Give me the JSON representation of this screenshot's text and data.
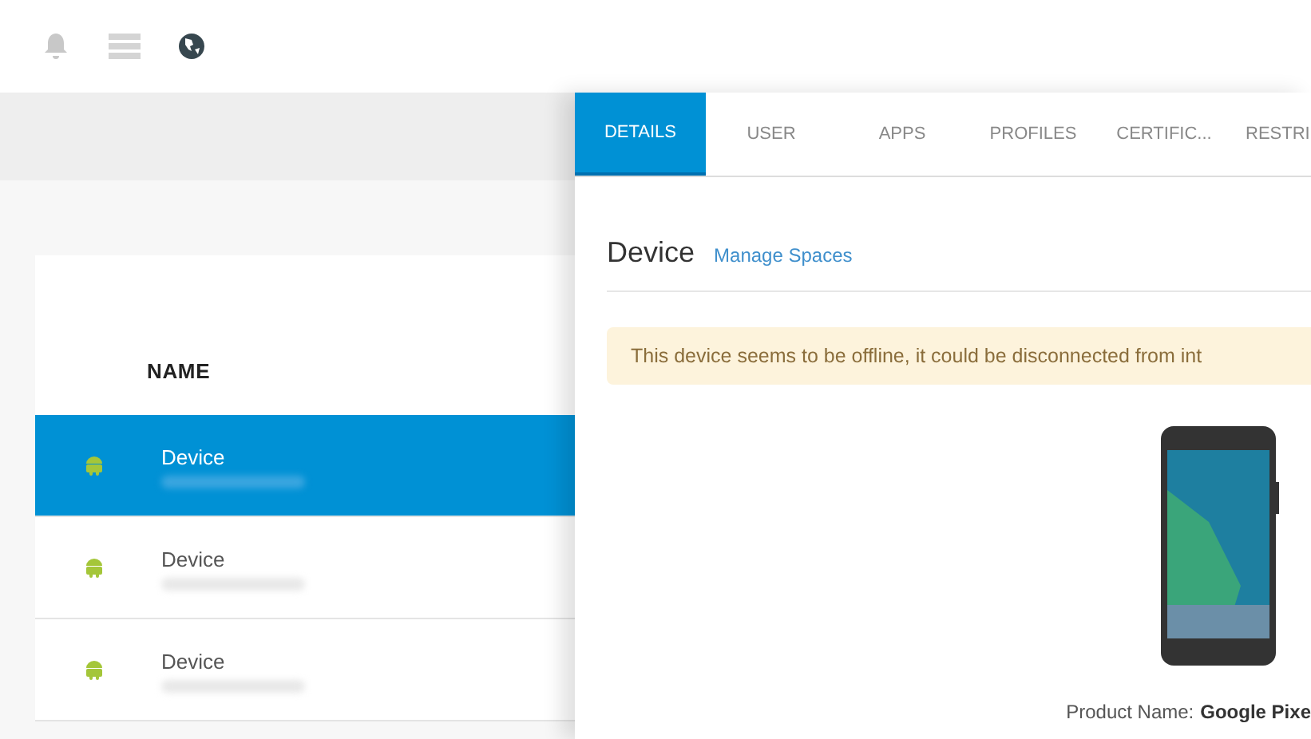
{
  "table": {
    "column": "NAME",
    "rows": [
      {
        "name": "Device",
        "selected": true
      },
      {
        "name": "Device",
        "selected": false
      },
      {
        "name": "Device",
        "selected": false
      }
    ]
  },
  "panel": {
    "tabs": [
      {
        "label": "DETAILS",
        "selected": true
      },
      {
        "label": "USER",
        "selected": false
      },
      {
        "label": "APPS",
        "selected": false
      },
      {
        "label": "PROFILES",
        "selected": false
      },
      {
        "label": "CERTIFIC...",
        "selected": false
      },
      {
        "label": "RESTRI",
        "selected": false
      }
    ],
    "title": "Device",
    "link": "Manage Spaces",
    "alert": "This device seems to be offline, it could be disconnected from int",
    "product_label": "Product Name:",
    "product_value": "Google Pixe"
  }
}
